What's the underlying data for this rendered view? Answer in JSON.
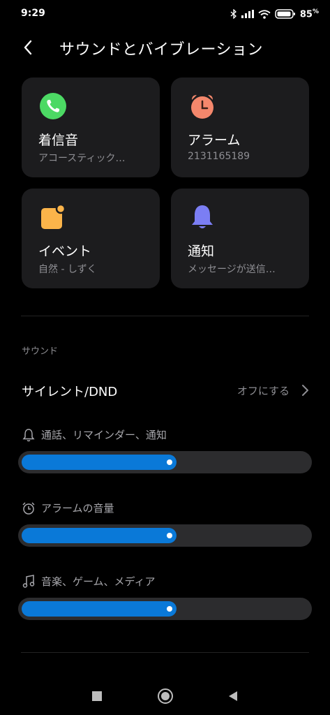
{
  "status": {
    "time": "9:29",
    "battery": "85",
    "battery_unit": "%",
    "icons": [
      "bluetooth-icon",
      "signal-icon",
      "wifi-icon",
      "battery-icon"
    ]
  },
  "header": {
    "title": "サウンドとバイブレーション"
  },
  "cards": [
    {
      "title": "着信音",
      "subtitle": "アコースティック…",
      "icon": "phone-icon",
      "color": "#4cd964"
    },
    {
      "title": "アラーム",
      "subtitle": "2131165189",
      "icon": "alarm-clock-icon",
      "color": "#f4876c"
    },
    {
      "title": "イベント",
      "subtitle": "自然 - しずく",
      "icon": "event-icon",
      "color": "#fbb44a"
    },
    {
      "title": "通知",
      "subtitle": "メッセージが送信…",
      "icon": "bell-icon",
      "color": "#7b7ef4"
    }
  ],
  "sound_section": {
    "label": "サウンド",
    "dnd_label": "サイレント/DND",
    "dnd_value": "オフにする"
  },
  "volumes": [
    {
      "label": "通話、リマインダー、通知",
      "icon": "bell-outline-icon",
      "level": 0.54
    },
    {
      "label": "アラームの音量",
      "icon": "alarm-outline-icon",
      "level": 0.54
    },
    {
      "label": "音楽、ゲーム、メディア",
      "icon": "music-note-icon",
      "level": 0.54
    }
  ],
  "colors": {
    "accent": "#0a79d8",
    "card_bg": "#1c1c1e",
    "track": "#2c2c2e"
  }
}
